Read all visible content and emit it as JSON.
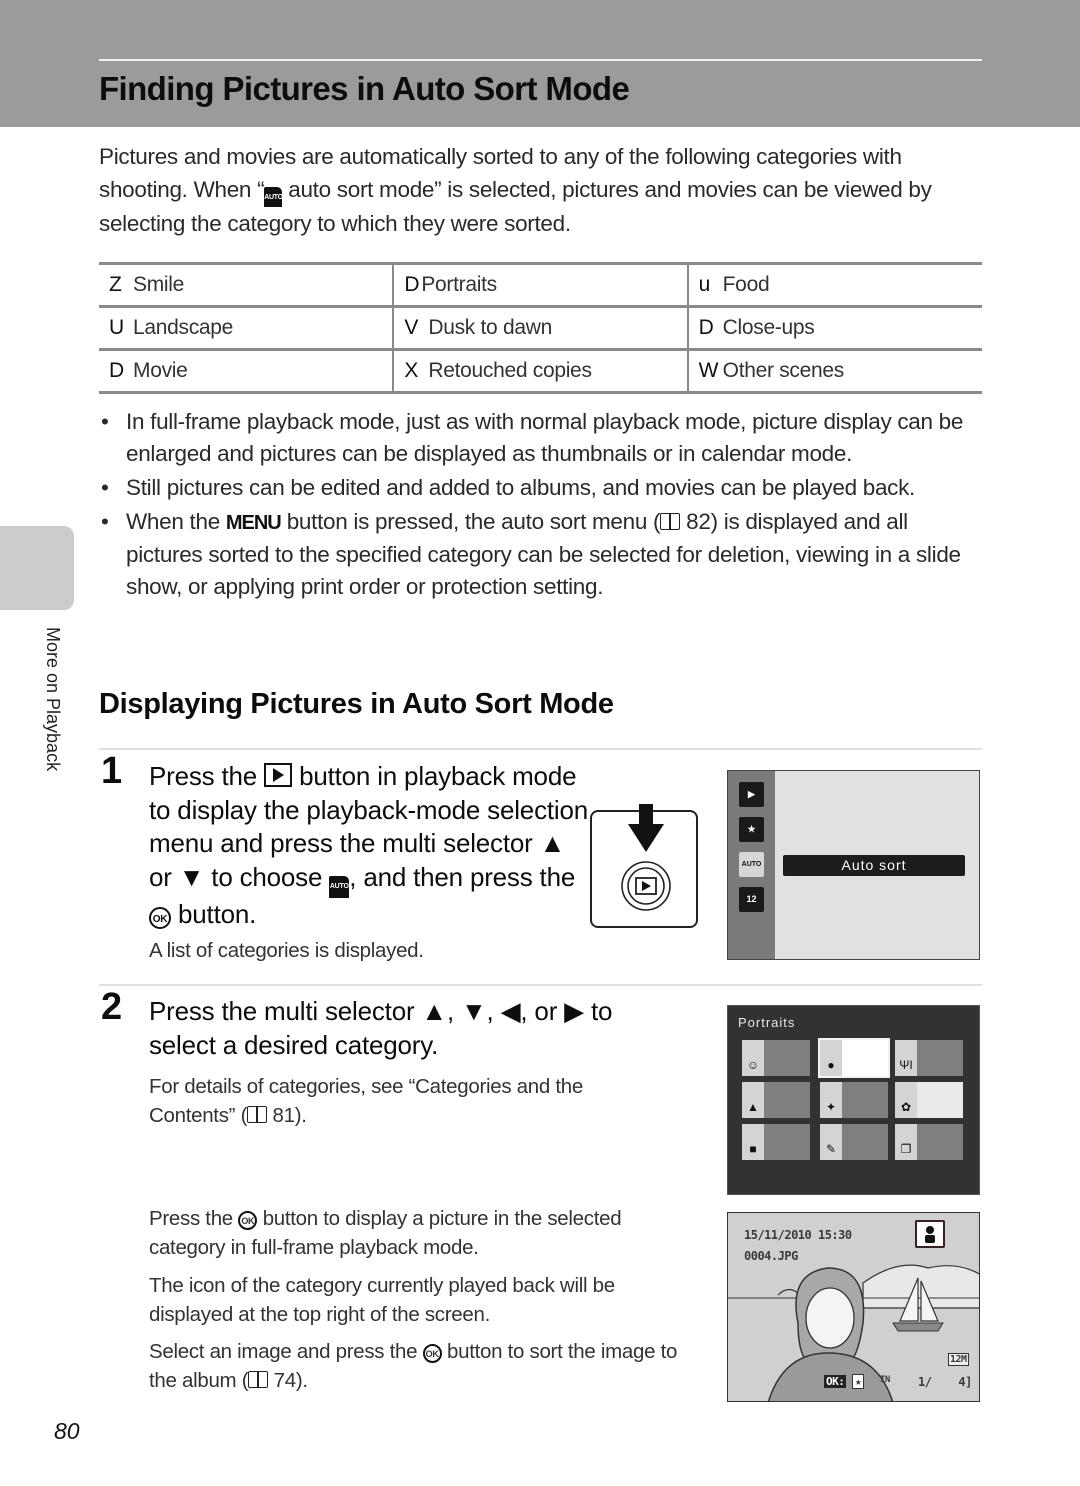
{
  "header": {
    "title": "Finding Pictures in Auto Sort Mode"
  },
  "intro": {
    "text_before": "Pictures and movies are automatically sorted to any of the following categories with shooting. When “",
    "icon": "auto-sort-icon",
    "icon_text": "AUTO",
    "text_after": " auto sort mode” is selected, pictures and movies can be viewed by selecting the category to which they were sorted."
  },
  "categories": [
    [
      {
        "glyph": "Z",
        "label": "Smile"
      },
      {
        "glyph": "D",
        "label": "Portraits"
      },
      {
        "glyph": "u",
        "label": "Food"
      }
    ],
    [
      {
        "glyph": "U",
        "label": "Landscape"
      },
      {
        "glyph": "V",
        "label": "Dusk to dawn"
      },
      {
        "glyph": "D",
        "label": "Close-ups"
      }
    ],
    [
      {
        "glyph": "D",
        "label": "Movie"
      },
      {
        "glyph": "X",
        "label": "Retouched copies"
      },
      {
        "glyph": "W",
        "label": "Other scenes"
      }
    ]
  ],
  "bullets": {
    "b1": "In full-frame playback mode, just as with normal playback mode, picture display can be enlarged and pictures can be displayed as thumbnails or in calendar mode.",
    "b2": "Still pictures can be edited and added to albums, and movies can be played back.",
    "b3_a": "When the ",
    "b3_menu": "MENU",
    "b3_b": " button is pressed, the auto sort menu (",
    "b3_ref": " 82) is displayed and all pictures sorted to the specified category can be selected for deletion, viewing in a slide show, or applying print order or protection setting.",
    "bullet_char": "•"
  },
  "sidebar": {
    "label": "More on Playback"
  },
  "section": {
    "title": "Displaying Pictures in Auto Sort Mode"
  },
  "step1": {
    "number": "1",
    "t1": "Press the ",
    "t2": " button in playback mode to display the playback-mode selection menu and press the multi selector ▲ or ▼ to choose ",
    "t3": ", and then press the ",
    "ok": "OK",
    "t4": " button.",
    "sub": "A list of categories is displayed."
  },
  "screen1": {
    "menu_icons": [
      "playback-icon",
      "favorites-icon",
      "auto-sort-icon",
      "list-by-date-icon"
    ],
    "icon_labels": [
      "▶",
      "★",
      "AUTO",
      "12"
    ],
    "selected_index": 2,
    "selected_label": "Auto sort"
  },
  "step2": {
    "number": "2",
    "heading": "Press the multi selector ▲, ▼, ◀, or ▶ to select a desired category.",
    "sub_a": "For details of categories, see “Categories and the Contents” (",
    "sub_b": " 81).",
    "p1_a": "Press the ",
    "p1_b": " button to display a picture in the selected category in full-frame playback mode.",
    "p2": "The icon of the category currently played back will be displayed at the top right of the screen.",
    "p3_a": "Select an image and press the ",
    "p3_b": " button to sort the image to the album (",
    "p3_c": " 74)."
  },
  "screen2": {
    "title": "Portraits",
    "cells": [
      {
        "icon": "smile-icon",
        "glyph": "☺"
      },
      {
        "icon": "portrait-icon",
        "glyph": "●",
        "selected": true
      },
      {
        "icon": "food-icon",
        "glyph": "ΨΙ"
      },
      {
        "icon": "landscape-icon",
        "glyph": "▲"
      },
      {
        "icon": "dusk-to-dawn-icon",
        "glyph": "✦"
      },
      {
        "icon": "close-up-icon",
        "glyph": "✿"
      },
      {
        "icon": "movie-icon",
        "glyph": "■"
      },
      {
        "icon": "retouch-icon",
        "glyph": "✎"
      },
      {
        "icon": "other-scenes-icon",
        "glyph": "❐"
      }
    ]
  },
  "screen3": {
    "datetime": "15/11/2010 15:30",
    "filename": "0004.JPG",
    "image_size": "12M",
    "ok_hint": "OK:",
    "memory": "IN",
    "counter": "1/    4]"
  },
  "footer": {
    "page_number": "80"
  }
}
